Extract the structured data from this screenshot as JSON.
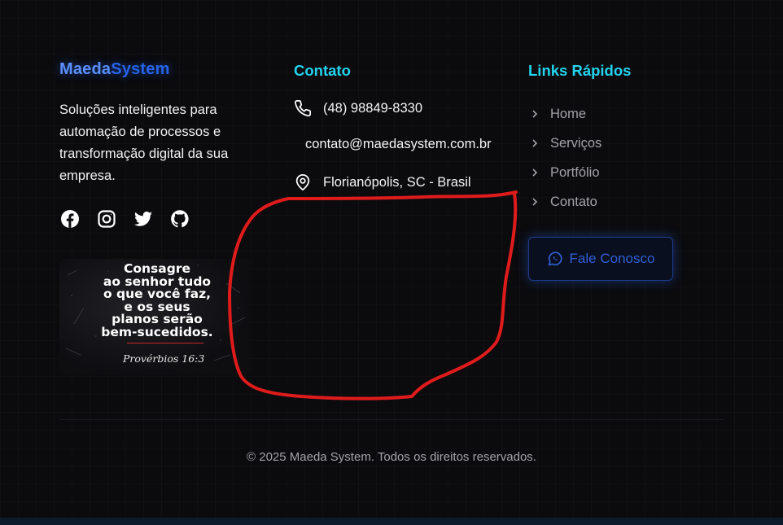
{
  "brand": {
    "part1": "Maeda",
    "part2": "System",
    "description": "Soluções inteligentes para automação de processos e transformação digital da sua empresa."
  },
  "socials": [
    {
      "icon": "facebook-icon"
    },
    {
      "icon": "instagram-icon"
    },
    {
      "icon": "twitter-icon"
    },
    {
      "icon": "github-icon"
    }
  ],
  "verse_card": {
    "text": "Consagre\nao senhor tudo\no que você faz,\ne os seus\nplanos serão\nbem-sucedidos.",
    "reference": "Provérbios 16:3"
  },
  "contact": {
    "heading": "Contato",
    "phone": "(48) 98849-8330",
    "email": "contato@maedasystem.com.br",
    "location": "Florianópolis, SC - Brasil"
  },
  "quick_links": {
    "heading": "Links Rápidos",
    "items": [
      "Home",
      "Serviços",
      "Portfólio",
      "Contato"
    ],
    "cta_label": "Fale Conosco"
  },
  "footer": {
    "copyright": "© 2025 Maeda System. Todos os direitos reservados."
  },
  "colors": {
    "background": "#0b0b0e",
    "accent_cyan": "#22d3ee",
    "brand_blue": "#2563eb",
    "annotation_red": "#e01b1b"
  }
}
